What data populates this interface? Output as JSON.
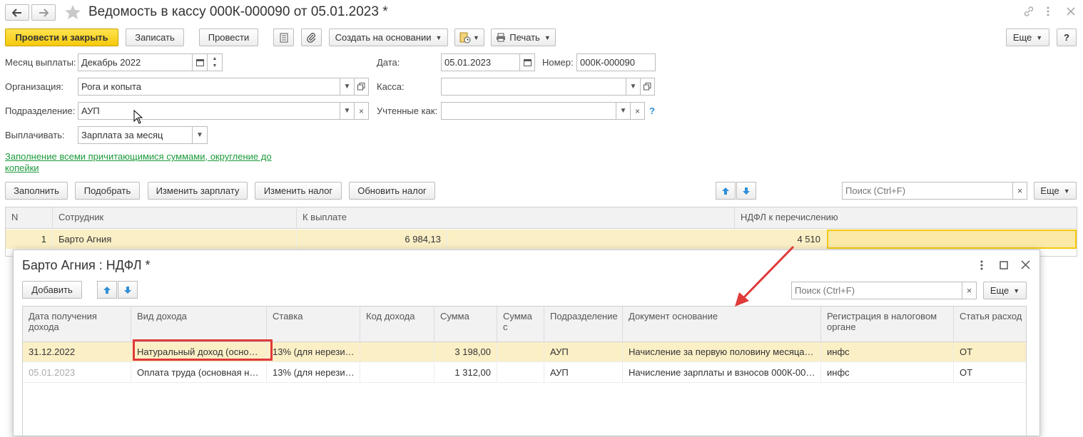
{
  "window": {
    "title": "Ведомость в кассу 000К-000090 от 05.01.2023 *"
  },
  "toolbar": {
    "post_close": "Провести и закрыть",
    "save": "Записать",
    "post": "Провести",
    "create_based": "Создать на основании",
    "print": "Печать",
    "more": "Еще",
    "help": "?"
  },
  "form": {
    "month_label": "Месяц выплаты:",
    "month_value": "Декабрь 2022",
    "date_label": "Дата:",
    "date_value": "05.01.2023",
    "number_label": "Номер:",
    "number_value": "000К-000090",
    "org_label": "Организация:",
    "org_value": "Рога и копыта",
    "cash_label": "Касса:",
    "cash_value": "",
    "dept_label": "Подразделение:",
    "dept_value": "АУП",
    "counted_label": "Учтенные как:",
    "counted_value": "",
    "counted_help": "?",
    "pay_label": "Выплачивать:",
    "pay_value": "Зарплата за месяц",
    "fill_link": "Заполнение всеми причитающимися суммами, округление до копейки"
  },
  "actions": {
    "fill": "Заполнить",
    "pick": "Подобрать",
    "change_salary": "Изменить зарплату",
    "change_tax": "Изменить налог",
    "update_tax": "Обновить налог",
    "search_placeholder": "Поиск (Ctrl+F)",
    "more": "Еще",
    "clear": "×"
  },
  "main_table": {
    "headers": [
      "N",
      "Сотрудник",
      "К выплате",
      "НДФЛ к перечислению"
    ],
    "rows": [
      {
        "n": "1",
        "employee": "Барто Агния",
        "pay": "6 984,13",
        "ndfl": "4 510"
      }
    ]
  },
  "dialog": {
    "title": "Барто Агния : НДФЛ *",
    "add": "Добавить",
    "search_placeholder": "Поиск (Ctrl+F)",
    "more": "Еще",
    "clear": "×",
    "headers": [
      "Дата получения дохода",
      "Вид дохода",
      "Ставка",
      "Код дохода",
      "Сумма",
      "Сумма с",
      "Подразделение",
      "Документ основание",
      "Регистрация в налоговом органе",
      "Статья расход"
    ],
    "rows": [
      {
        "date": "31.12.2022",
        "type": "Натуральный доход (осно…",
        "rate": "13% (для нерези…",
        "code": "",
        "sum": "3 198,00",
        "sum2": "",
        "dept": "АУП",
        "doc": "Начисление за первую половину месяца…",
        "reg": "инфс",
        "art": "ОТ"
      },
      {
        "date": "05.01.2023",
        "type": "Оплата труда (основная н…",
        "rate": "13% (для нерези…",
        "code": "",
        "sum": "1 312,00",
        "sum2": "",
        "dept": "АУП",
        "doc": "Начисление зарплаты и взносов 000К-00…",
        "reg": "инфс",
        "art": "ОТ"
      }
    ]
  },
  "colors": {
    "accent_yellow": "#f5c90a",
    "selected_row": "#fbefc6",
    "link_green": "#1b9a3a",
    "annotation_red": "#e03a3a",
    "arrow_blue": "#2f8fd8"
  }
}
